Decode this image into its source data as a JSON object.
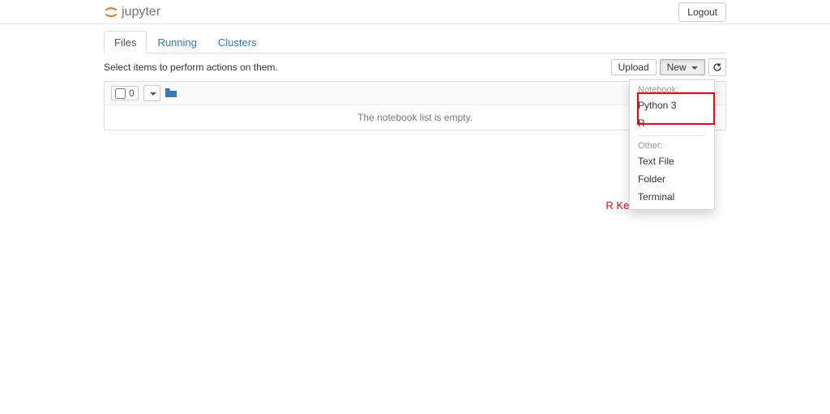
{
  "header": {
    "brand": "jupyter",
    "logout": "Logout"
  },
  "tabs": {
    "files": "Files",
    "running": "Running",
    "clusters": "Clusters"
  },
  "subheading": {
    "hint": "Select items to perform actions on them.",
    "upload": "Upload",
    "new": "New",
    "selected_count": "0"
  },
  "listing": {
    "empty": "The notebook list is empty."
  },
  "new_menu": {
    "notebook_header": "Notebook:",
    "python3": "Python 3",
    "r": "R",
    "other_header": "Other:",
    "textfile": "Text File",
    "folder": "Folder",
    "terminal": "Terminal"
  },
  "annotation": {
    "text": "R Kernelが表示される"
  }
}
